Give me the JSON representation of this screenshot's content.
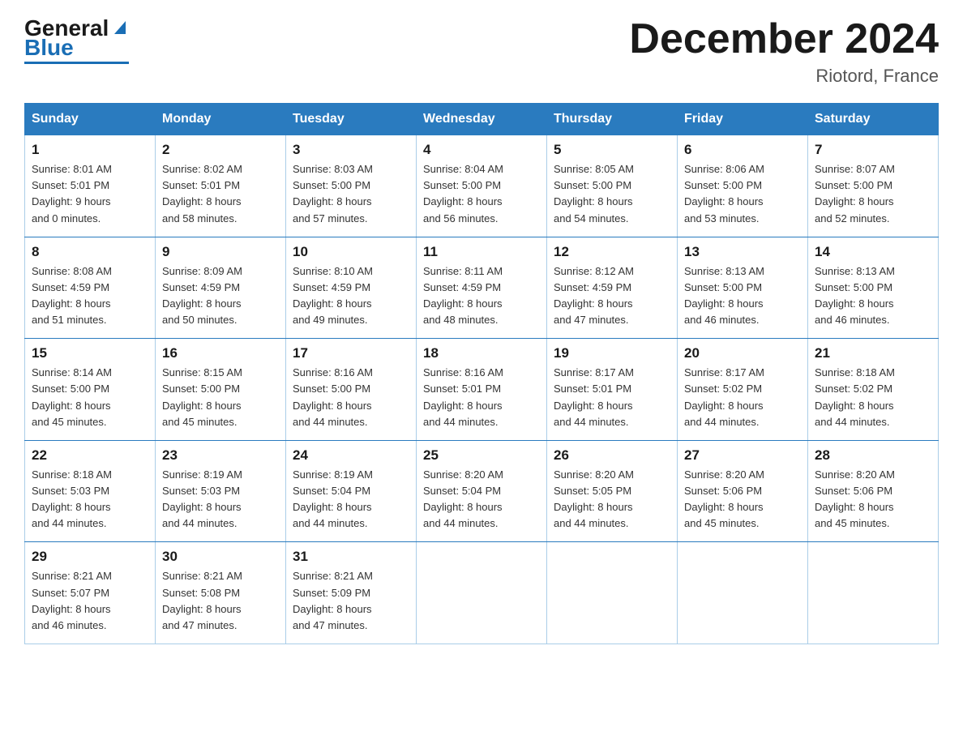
{
  "header": {
    "logo_general": "General",
    "logo_blue": "Blue",
    "month_title": "December 2024",
    "location": "Riotord, France"
  },
  "days_of_week": [
    "Sunday",
    "Monday",
    "Tuesday",
    "Wednesday",
    "Thursday",
    "Friday",
    "Saturday"
  ],
  "weeks": [
    [
      {
        "num": "1",
        "sunrise": "8:01 AM",
        "sunset": "5:01 PM",
        "daylight": "9 hours",
        "daylight2": "and 0 minutes."
      },
      {
        "num": "2",
        "sunrise": "8:02 AM",
        "sunset": "5:01 PM",
        "daylight": "8 hours",
        "daylight2": "and 58 minutes."
      },
      {
        "num": "3",
        "sunrise": "8:03 AM",
        "sunset": "5:00 PM",
        "daylight": "8 hours",
        "daylight2": "and 57 minutes."
      },
      {
        "num": "4",
        "sunrise": "8:04 AM",
        "sunset": "5:00 PM",
        "daylight": "8 hours",
        "daylight2": "and 56 minutes."
      },
      {
        "num": "5",
        "sunrise": "8:05 AM",
        "sunset": "5:00 PM",
        "daylight": "8 hours",
        "daylight2": "and 54 minutes."
      },
      {
        "num": "6",
        "sunrise": "8:06 AM",
        "sunset": "5:00 PM",
        "daylight": "8 hours",
        "daylight2": "and 53 minutes."
      },
      {
        "num": "7",
        "sunrise": "8:07 AM",
        "sunset": "5:00 PM",
        "daylight": "8 hours",
        "daylight2": "and 52 minutes."
      }
    ],
    [
      {
        "num": "8",
        "sunrise": "8:08 AM",
        "sunset": "4:59 PM",
        "daylight": "8 hours",
        "daylight2": "and 51 minutes."
      },
      {
        "num": "9",
        "sunrise": "8:09 AM",
        "sunset": "4:59 PM",
        "daylight": "8 hours",
        "daylight2": "and 50 minutes."
      },
      {
        "num": "10",
        "sunrise": "8:10 AM",
        "sunset": "4:59 PM",
        "daylight": "8 hours",
        "daylight2": "and 49 minutes."
      },
      {
        "num": "11",
        "sunrise": "8:11 AM",
        "sunset": "4:59 PM",
        "daylight": "8 hours",
        "daylight2": "and 48 minutes."
      },
      {
        "num": "12",
        "sunrise": "8:12 AM",
        "sunset": "4:59 PM",
        "daylight": "8 hours",
        "daylight2": "and 47 minutes."
      },
      {
        "num": "13",
        "sunrise": "8:13 AM",
        "sunset": "5:00 PM",
        "daylight": "8 hours",
        "daylight2": "and 46 minutes."
      },
      {
        "num": "14",
        "sunrise": "8:13 AM",
        "sunset": "5:00 PM",
        "daylight": "8 hours",
        "daylight2": "and 46 minutes."
      }
    ],
    [
      {
        "num": "15",
        "sunrise": "8:14 AM",
        "sunset": "5:00 PM",
        "daylight": "8 hours",
        "daylight2": "and 45 minutes."
      },
      {
        "num": "16",
        "sunrise": "8:15 AM",
        "sunset": "5:00 PM",
        "daylight": "8 hours",
        "daylight2": "and 45 minutes."
      },
      {
        "num": "17",
        "sunrise": "8:16 AM",
        "sunset": "5:00 PM",
        "daylight": "8 hours",
        "daylight2": "and 44 minutes."
      },
      {
        "num": "18",
        "sunrise": "8:16 AM",
        "sunset": "5:01 PM",
        "daylight": "8 hours",
        "daylight2": "and 44 minutes."
      },
      {
        "num": "19",
        "sunrise": "8:17 AM",
        "sunset": "5:01 PM",
        "daylight": "8 hours",
        "daylight2": "and 44 minutes."
      },
      {
        "num": "20",
        "sunrise": "8:17 AM",
        "sunset": "5:02 PM",
        "daylight": "8 hours",
        "daylight2": "and 44 minutes."
      },
      {
        "num": "21",
        "sunrise": "8:18 AM",
        "sunset": "5:02 PM",
        "daylight": "8 hours",
        "daylight2": "and 44 minutes."
      }
    ],
    [
      {
        "num": "22",
        "sunrise": "8:18 AM",
        "sunset": "5:03 PM",
        "daylight": "8 hours",
        "daylight2": "and 44 minutes."
      },
      {
        "num": "23",
        "sunrise": "8:19 AM",
        "sunset": "5:03 PM",
        "daylight": "8 hours",
        "daylight2": "and 44 minutes."
      },
      {
        "num": "24",
        "sunrise": "8:19 AM",
        "sunset": "5:04 PM",
        "daylight": "8 hours",
        "daylight2": "and 44 minutes."
      },
      {
        "num": "25",
        "sunrise": "8:20 AM",
        "sunset": "5:04 PM",
        "daylight": "8 hours",
        "daylight2": "and 44 minutes."
      },
      {
        "num": "26",
        "sunrise": "8:20 AM",
        "sunset": "5:05 PM",
        "daylight": "8 hours",
        "daylight2": "and 44 minutes."
      },
      {
        "num": "27",
        "sunrise": "8:20 AM",
        "sunset": "5:06 PM",
        "daylight": "8 hours",
        "daylight2": "and 45 minutes."
      },
      {
        "num": "28",
        "sunrise": "8:20 AM",
        "sunset": "5:06 PM",
        "daylight": "8 hours",
        "daylight2": "and 45 minutes."
      }
    ],
    [
      {
        "num": "29",
        "sunrise": "8:21 AM",
        "sunset": "5:07 PM",
        "daylight": "8 hours",
        "daylight2": "and 46 minutes."
      },
      {
        "num": "30",
        "sunrise": "8:21 AM",
        "sunset": "5:08 PM",
        "daylight": "8 hours",
        "daylight2": "and 47 minutes."
      },
      {
        "num": "31",
        "sunrise": "8:21 AM",
        "sunset": "5:09 PM",
        "daylight": "8 hours",
        "daylight2": "and 47 minutes."
      },
      null,
      null,
      null,
      null
    ]
  ]
}
